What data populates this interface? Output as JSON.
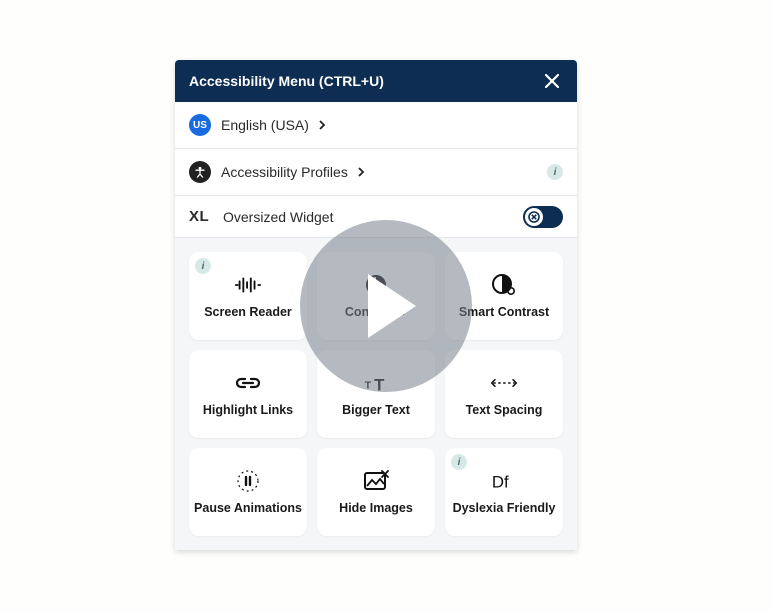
{
  "header": {
    "title": "Accessibility Menu (CTRL+U)"
  },
  "rows": {
    "language": {
      "label": "English (USA)",
      "badge": "US"
    },
    "profiles": {
      "label": "Accessibility Profiles"
    },
    "oversized": {
      "label": "Oversized Widget",
      "icon_text": "XL"
    }
  },
  "cards": [
    {
      "id": "screen-reader",
      "label": "Screen Reader",
      "info": true
    },
    {
      "id": "contrast",
      "label": "Contrast +",
      "info": false
    },
    {
      "id": "smart-contrast",
      "label": "Smart Contrast",
      "info": false
    },
    {
      "id": "highlight-links",
      "label": "Highlight Links",
      "info": false
    },
    {
      "id": "bigger-text",
      "label": "Bigger Text",
      "info": false
    },
    {
      "id": "text-spacing",
      "label": "Text Spacing",
      "info": false
    },
    {
      "id": "pause-animations",
      "label": "Pause Animations",
      "info": false
    },
    {
      "id": "hide-images",
      "label": "Hide Images",
      "info": false
    },
    {
      "id": "dyslexia-friendly",
      "label": "Dyslexia Friendly",
      "info": true
    }
  ],
  "info_glyph": "i"
}
